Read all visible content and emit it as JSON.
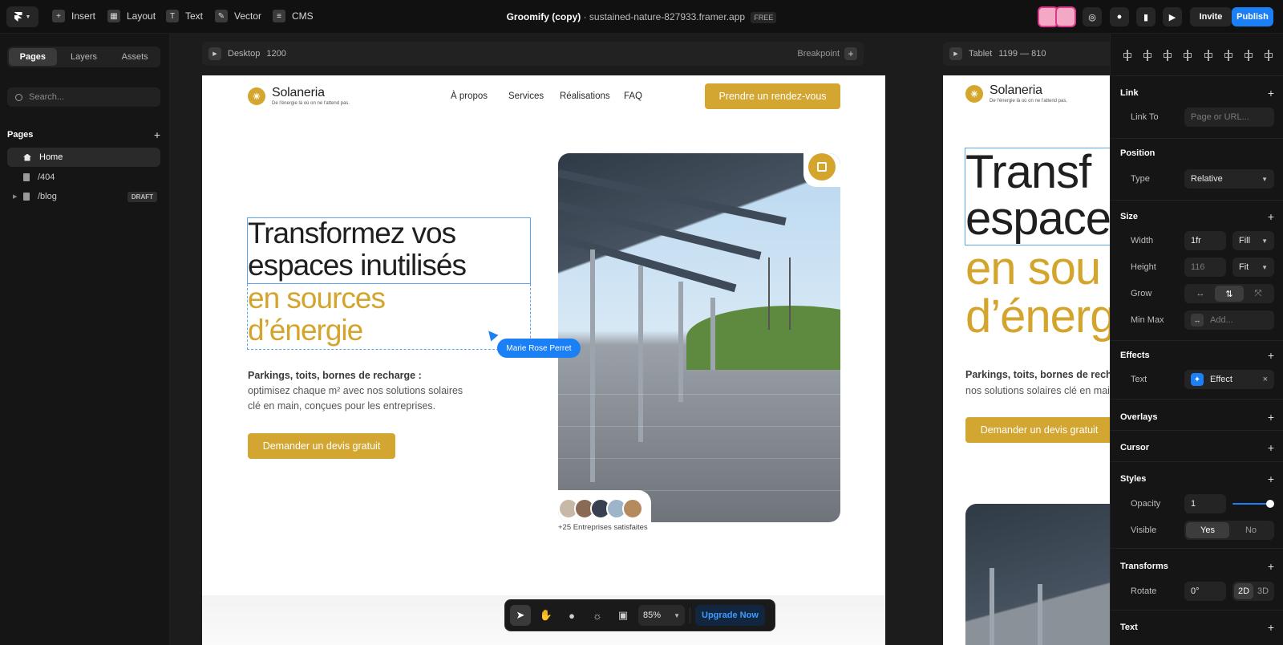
{
  "topbar": {
    "menu": [
      "Insert",
      "Layout",
      "Text",
      "Vector",
      "CMS"
    ],
    "project_name": "Groomify (copy)",
    "project_separator": "·",
    "project_url": "sustained-nature-827933.framer.app",
    "plan_badge": "FREE",
    "invite_label": "Invite",
    "publish_label": "Publish"
  },
  "left_panel": {
    "tabs": [
      "Pages",
      "Layers",
      "Assets"
    ],
    "search_placeholder": "Search...",
    "pages_heading": "Pages",
    "pages": [
      {
        "label": "Home"
      },
      {
        "label": "/404"
      },
      {
        "label": "/blog",
        "badge": "DRAFT"
      }
    ]
  },
  "canvas": {
    "desktop_frame": {
      "name": "Desktop",
      "width": "1200",
      "breakpoint_label": "Breakpoint"
    },
    "tablet_frame": {
      "name": "Tablet",
      "range": "1199 — 810"
    },
    "collaborator_cursor": "Marie Rose Perret"
  },
  "site": {
    "brand": "Solaneria",
    "tagline": "De l'énergie là où on ne l'attend pas.",
    "nav": [
      "À propos",
      "Services",
      "Réalisations",
      "FAQ"
    ],
    "nav_cta": "Prendre un rendez-vous",
    "hero_line1": "Transformez vos",
    "hero_line2": "espaces inutilisés",
    "hero_line3": "en sources",
    "hero_line4": "d’énergie",
    "subtitle_strong": "Parkings, toits, bornes de recharge :",
    "subtitle_line1": "optimisez chaque m² avec nos solutions solaires",
    "subtitle_line2": "clé en main, conçues pour les entreprises.",
    "tablet_subtitle_line1": "Parkings, toits, bornes de recha",
    "tablet_subtitle_line2": "nos solutions solaires clé en main",
    "tablet_hero_line1": "Transf",
    "tablet_hero_line2": "espace",
    "tablet_hero_line3": "en sou",
    "tablet_hero_line4": "d’énerg",
    "hero_cta": "Demander un devis gratuit",
    "satisfied": "+25 Entreprises satisfaites"
  },
  "toolbar_bottom": {
    "zoom": "85%",
    "upgrade_label": "Upgrade Now"
  },
  "right_panel": {
    "link": {
      "heading": "Link",
      "label": "Link To",
      "placeholder": "Page or URL..."
    },
    "position": {
      "heading": "Position",
      "label": "Type",
      "value": "Relative"
    },
    "size": {
      "heading": "Size",
      "width_label": "Width",
      "width_value": "1fr",
      "width_mode": "Fill",
      "height_label": "Height",
      "height_value": "116",
      "height_mode": "Fit",
      "grow_label": "Grow",
      "minmax_label": "Min Max",
      "minmax_placeholder": "Add..."
    },
    "effects": {
      "heading": "Effects",
      "label": "Text",
      "value": "Effect"
    },
    "overlays_heading": "Overlays",
    "cursor_heading": "Cursor",
    "styles": {
      "heading": "Styles",
      "opacity_label": "Opacity",
      "opacity_value": "1",
      "visible_label": "Visible",
      "visible_yes": "Yes",
      "visible_no": "No"
    },
    "transforms": {
      "heading": "Transforms",
      "rotate_label": "Rotate",
      "rotate_value": "0°",
      "mode_2d": "2D",
      "mode_3d": "3D"
    },
    "text_heading": "Text"
  },
  "colors": {
    "accent_blue": "#1b7ff5",
    "brand_gold": "#d3a52c",
    "dark_bg": "#111111"
  }
}
